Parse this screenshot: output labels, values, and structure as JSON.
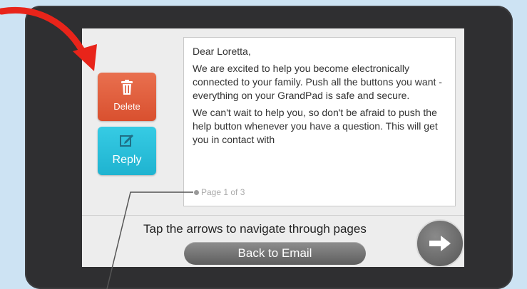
{
  "letter": {
    "greeting": "Dear Loretta,",
    "paragraph1": "We are excited to help you become electronically connected to your family. Push all the buttons you want - everything on your GrandPad is safe and secure.",
    "paragraph2": "We can't wait to help you, so don't be afraid to push the help button whenever you have a question. This will get you in contact with",
    "page_indicator": "Page 1 of 3"
  },
  "actions": {
    "delete_label": "Delete",
    "reply_label": "Reply"
  },
  "footer": {
    "tip": "Tap the arrows to navigate through pages",
    "back_label": "Back to Email"
  },
  "icons": {
    "delete": "trash-icon",
    "reply": "compose-icon",
    "next": "arrow-right-icon",
    "annotation": "red-arrow-icon"
  },
  "colors": {
    "background": "#cde3f3",
    "device_frame": "#2f2f31",
    "delete": "#d9502f",
    "reply": "#1fb3d0",
    "annotation_arrow": "#e8241a",
    "back_button": "#6b6b6b"
  }
}
